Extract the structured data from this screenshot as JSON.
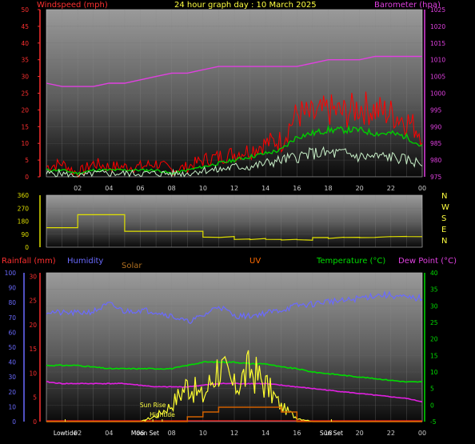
{
  "title": "24 hour graph day : 10 March 2025",
  "colors": {
    "wind": "#ff0000",
    "gust": "#ff0000",
    "avg": "#00cc00",
    "barometer": "#e040e0",
    "direction": "#e0e000",
    "rainfall": "#ff2020",
    "humidity": "#6a6aff",
    "temperature": "#00dd00",
    "dewpoint": "#e020e0",
    "solar": "#ffff30",
    "uv": "#d06000",
    "axis_left": "#ff3030",
    "axis_right": "#e040e0",
    "temp_axis": "#00dd00",
    "humidity_axis": "#6a6aff"
  },
  "chart_data": [
    {
      "type": "line",
      "name": "wind-baro",
      "title": "24 hour graph day : 10 March 2025",
      "ylabel": "Windspeed (mph)",
      "y2label": "Barometer (hpa)",
      "ylim": [
        0,
        50
      ],
      "y2lim": [
        975,
        1025
      ],
      "yticks": [
        "0",
        "5",
        "10",
        "15",
        "20",
        "25",
        "30",
        "35",
        "40",
        "45",
        "50"
      ],
      "y2ticks": [
        "975",
        "980",
        "985",
        "990",
        "995",
        "1000",
        "1005",
        "1010",
        "1015",
        "1020",
        "1025"
      ],
      "xticks": [
        "02",
        "04",
        "06",
        "08",
        "10",
        "12",
        "14",
        "16",
        "18",
        "20",
        "22",
        "00"
      ],
      "x": [
        0,
        1,
        2,
        3,
        4,
        5,
        6,
        7,
        8,
        9,
        10,
        11,
        12,
        13,
        14,
        15,
        16,
        17,
        18,
        19,
        20,
        21,
        22,
        23,
        24
      ],
      "series": [
        {
          "key": "gust",
          "values": [
            3,
            4,
            1,
            4,
            3,
            3,
            3,
            4,
            2,
            3,
            5,
            6,
            7,
            8,
            10,
            11,
            19,
            18,
            20,
            19,
            21,
            20,
            19,
            17,
            13
          ]
        },
        {
          "key": "avg",
          "values": [
            2,
            2,
            1,
            2,
            2,
            2,
            2,
            2,
            1,
            2,
            3,
            4,
            5,
            6,
            7,
            8,
            12,
            13,
            14,
            14,
            14,
            13,
            13,
            12,
            9
          ]
        },
        {
          "key": "wind",
          "values": [
            1,
            1,
            0,
            1,
            1,
            1,
            1,
            1,
            1,
            1,
            2,
            2,
            3,
            3,
            4,
            5,
            6,
            7,
            7,
            7,
            6,
            6,
            6,
            5,
            4
          ]
        },
        {
          "key": "barometer",
          "values": [
            1003,
            1002,
            1002,
            1002,
            1003,
            1003,
            1004,
            1005,
            1006,
            1006,
            1007,
            1008,
            1008,
            1008,
            1008,
            1008,
            1008,
            1009,
            1010,
            1010,
            1010,
            1011,
            1011,
            1011,
            1011
          ]
        }
      ]
    },
    {
      "type": "line",
      "name": "wind-direction",
      "ylim": [
        0,
        360
      ],
      "yticks": [
        "0",
        "90",
        "180",
        "270",
        "360"
      ],
      "compass": [
        "N",
        "W",
        "S",
        "E",
        "N"
      ],
      "x": [
        0,
        1,
        2,
        3,
        4,
        5,
        6,
        7,
        8,
        9,
        10,
        11,
        12,
        13,
        14,
        15,
        16,
        17,
        18,
        19,
        20,
        21,
        22,
        23,
        24
      ],
      "series": [
        {
          "key": "direction",
          "values": [
            135,
            135,
            225,
            225,
            225,
            110,
            110,
            110,
            110,
            110,
            70,
            70,
            55,
            55,
            55,
            50,
            50,
            65,
            65,
            65,
            70,
            70,
            72,
            75,
            75
          ]
        }
      ]
    },
    {
      "type": "line",
      "name": "rain-hum-temp",
      "labels": {
        "rainfall": "Rainfall (mm)",
        "humidity": "Humidity",
        "solar": "Solar",
        "uv": "UV",
        "temperature": "Temperature (°C)",
        "dewpoint": "Dew Point (°C)"
      },
      "humidity_ticks": [
        "0",
        "10",
        "20",
        "30",
        "40",
        "50",
        "60",
        "70",
        "80",
        "90",
        "100"
      ],
      "rain_ticks": [
        "0",
        "5",
        "10",
        "15",
        "20",
        "25",
        "30"
      ],
      "temp_ticks": [
        "-5",
        "0",
        "5",
        "10",
        "15",
        "20",
        "25",
        "30",
        "35",
        "40"
      ],
      "xticks": [
        "02",
        "04",
        "06",
        "08",
        "10",
        "12",
        "14",
        "16",
        "18",
        "20",
        "22",
        "00"
      ],
      "x": [
        0,
        1,
        2,
        3,
        4,
        5,
        6,
        7,
        8,
        9,
        10,
        11,
        12,
        13,
        14,
        15,
        16,
        17,
        18,
        19,
        20,
        21,
        22,
        23,
        24
      ],
      "series": [
        {
          "key": "humidity",
          "values": [
            74,
            73,
            73,
            74,
            79,
            74,
            75,
            74,
            71,
            67,
            71,
            78,
            71,
            71,
            73,
            75,
            78,
            79,
            81,
            81,
            83,
            85,
            85,
            83,
            83
          ]
        },
        {
          "key": "temperature",
          "values": [
            12,
            12,
            12,
            11.5,
            11,
            11,
            11,
            11,
            11,
            12,
            13,
            13,
            13,
            12.5,
            12.5,
            11.5,
            11,
            10,
            9.5,
            9,
            8.5,
            8,
            7.5,
            7,
            7
          ]
        },
        {
          "key": "dewpoint",
          "values": [
            7,
            6.5,
            6.5,
            6.5,
            6.5,
            6.5,
            6,
            5.5,
            5.5,
            5.5,
            6,
            6.5,
            6.5,
            6.5,
            6.5,
            6,
            5.5,
            5,
            4.5,
            4,
            3.5,
            3,
            2.5,
            2,
            1
          ]
        },
        {
          "key": "rainfall",
          "values": [
            0,
            0,
            0,
            0,
            0,
            0,
            0,
            0,
            0,
            0,
            0,
            0,
            0,
            0,
            0,
            0,
            0,
            0,
            0,
            0,
            0,
            0,
            0,
            0,
            0
          ]
        },
        {
          "key": "solar",
          "values": [
            0,
            0,
            0,
            0,
            0,
            0,
            0,
            3,
            9,
            20,
            13,
            30,
            18,
            28,
            20,
            8,
            2,
            0,
            0,
            0,
            0,
            0,
            0,
            0,
            0
          ]
        },
        {
          "key": "uv",
          "values": [
            0,
            0,
            0,
            0,
            0,
            0,
            0,
            0,
            0,
            1,
            2,
            3,
            3,
            3,
            3,
            2,
            0,
            0,
            0,
            0,
            0,
            0,
            0,
            0,
            0
          ]
        }
      ],
      "events": [
        {
          "label": "Lowtide",
          "hour": 1.2
        },
        {
          "label": "Moon Set",
          "hour": 6.3
        },
        {
          "label": "Sun Rise",
          "hour": 6.8
        },
        {
          "label": "Hightide",
          "hour": 7.4
        },
        {
          "label": "Sun Set",
          "hour": 18.2
        }
      ]
    }
  ]
}
